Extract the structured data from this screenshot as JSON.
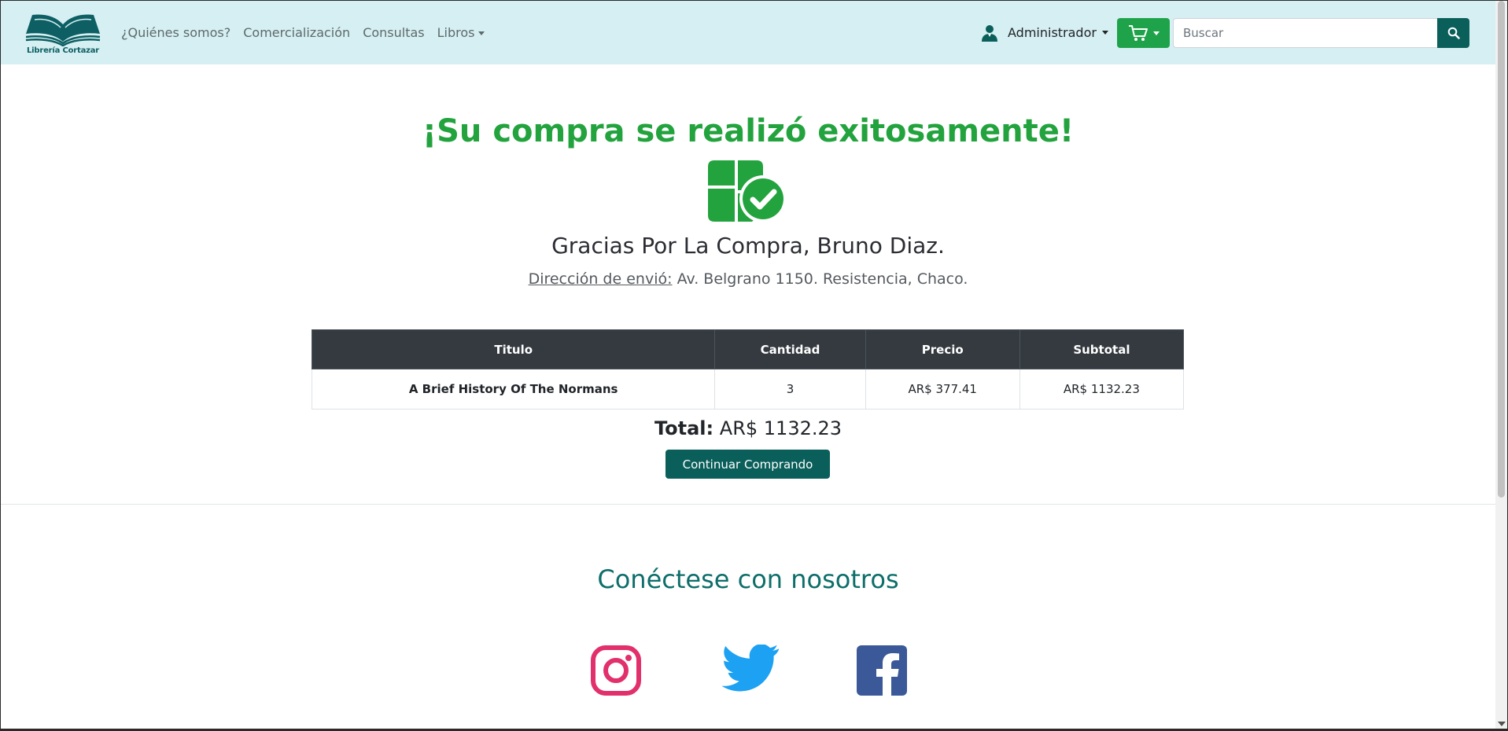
{
  "navbar": {
    "brand_name": "Librería Cortazar",
    "links": [
      {
        "label": "¿Quiénes somos?"
      },
      {
        "label": "Comercialización"
      },
      {
        "label": "Consultas"
      },
      {
        "label": "Libros"
      }
    ],
    "user_label": "Administrador",
    "search_placeholder": "Buscar"
  },
  "confirmation": {
    "title": "¡Su compra se realizó exitosamente!",
    "thanks": "Gracias Por La Compra, Bruno Diaz.",
    "address_label": "Dirección de envió:",
    "address_value": "Av. Belgrano 1150.  Resistencia, Chaco."
  },
  "table": {
    "headers": [
      "Titulo",
      "Cantidad",
      "Precio",
      "Subtotal"
    ],
    "rows": [
      {
        "title": "A Brief History Of The Normans",
        "quantity": "3",
        "price": "AR$ 377.41",
        "subtotal": "AR$ 1132.23"
      }
    ]
  },
  "total": {
    "label": "Total:",
    "value": "AR$ 1132.23"
  },
  "continue_label": "Continuar Comprando",
  "footer": {
    "connect_title": "Conéctese con nosotros",
    "socials": [
      "instagram-icon",
      "twitter-icon",
      "facebook-icon"
    ]
  },
  "colors": {
    "navbar_bg": "#d6eff2",
    "success_green": "#23a33e",
    "brand_teal": "#0b5f5b",
    "cart_green": "#1fa34a",
    "table_header": "#343a40",
    "instagram": "#e1306c",
    "twitter": "#1da1f2",
    "facebook": "#3b5998"
  }
}
